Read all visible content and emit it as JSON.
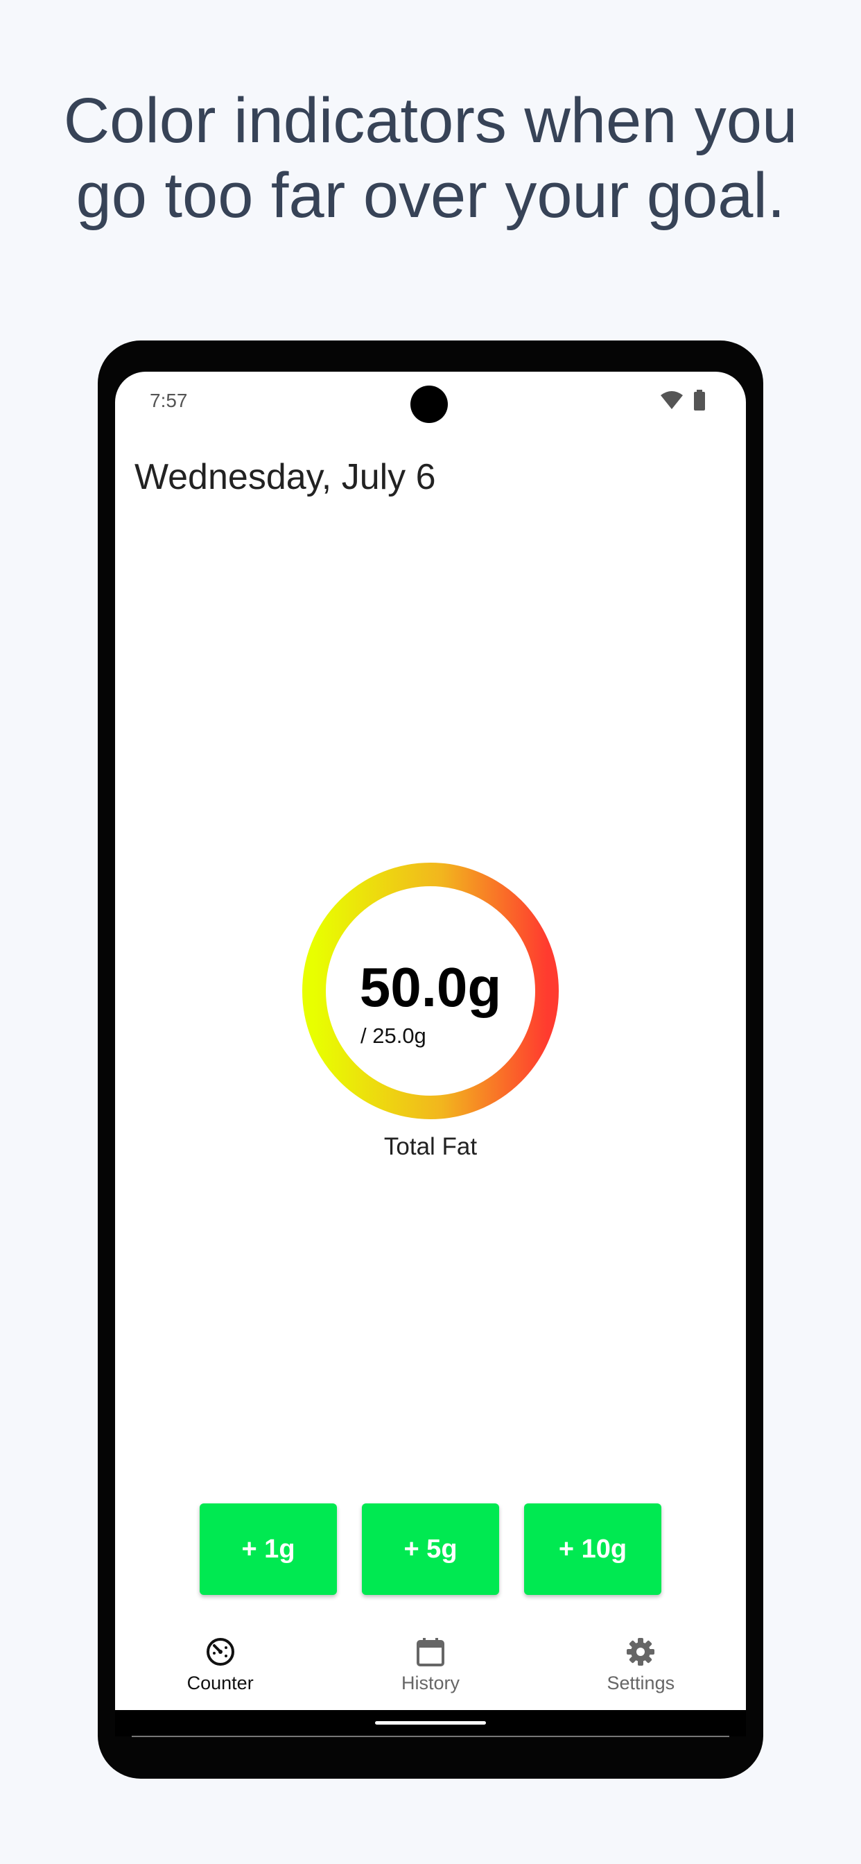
{
  "headline": {
    "line1": "Color indicators when you",
    "line2": "go too far over your goal."
  },
  "status_bar": {
    "time": "7:57",
    "icons": [
      "wifi-icon",
      "battery-icon"
    ]
  },
  "date_title": "Wednesday, July 6",
  "gauge": {
    "value": "50.0g",
    "goal": "/ 25.0g",
    "label": "Total Fat",
    "progress_fraction": 2.0,
    "colors": {
      "start": "#e8ff00",
      "mid": "#f2b51e",
      "end": "#ff3b2f"
    }
  },
  "buttons": [
    {
      "label": "+ 1g"
    },
    {
      "label": "+ 5g"
    },
    {
      "label": "+ 10g"
    }
  ],
  "button_color": "#00e951",
  "nav": {
    "items": [
      {
        "label": "Counter",
        "icon": "speedometer-icon",
        "active": true
      },
      {
        "label": "History",
        "icon": "calendar-icon",
        "active": false
      },
      {
        "label": "Settings",
        "icon": "gear-icon",
        "active": false
      }
    ]
  }
}
